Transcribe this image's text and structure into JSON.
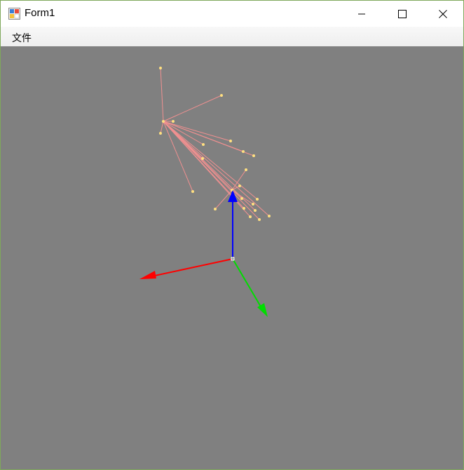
{
  "window": {
    "title": "Form1",
    "controls": [
      "minimize-icon",
      "maximize-icon",
      "close-icon"
    ]
  },
  "menu": {
    "items": [
      {
        "label": "文件"
      }
    ]
  },
  "viewport": {
    "background": "#808080",
    "axis_colors": {
      "x": "#ff0000",
      "y": "#00dd00",
      "z": "#0000ff"
    },
    "skeleton_line_color": "#f09090",
    "joint_color": "#ffe080"
  }
}
